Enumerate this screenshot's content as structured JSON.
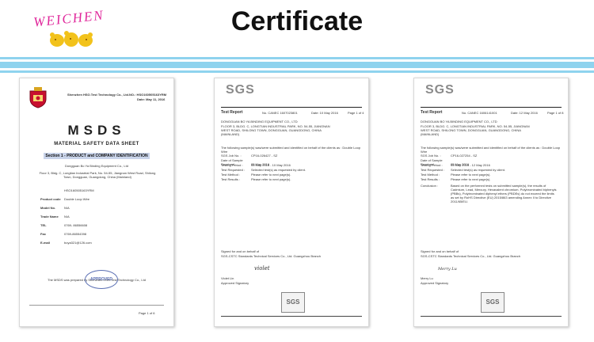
{
  "brand": {
    "logo_text": "WEICHEN"
  },
  "header": {
    "title": "Certificate"
  },
  "colors": {
    "stripe": "#8fd3ee",
    "logo": "#e0279b",
    "stamp": "#5a6fb3"
  },
  "doc1": {
    "company": "Shenzhen HSO.Test Technology Co., Ltd.",
    "report_no": "NO.: HSO160505163YRM",
    "date": "Date: May 11, 2016",
    "title": "MSDS",
    "subtitle": "MATERIAL SAFETY DATA SHEET",
    "section": "Section 1 - PRODUCT and COMPANY IDENTIFICATION",
    "applicant": "Dongguan  Bo Ya Binding Equipment Co., Ltd",
    "address": "Floor 3, Bldg. C, Longtian Industrial Park, No. 54-55, Jiangnan West Road, Shilong Town, Dongguan, Guangdong, China (Mainland)",
    "fields": [
      {
        "label": "",
        "value": "HSO160505163YRM"
      },
      {
        "label": "Product code",
        "value": "Double Loop Wire"
      },
      {
        "label": "Model No.",
        "value": "N/A"
      },
      {
        "label": "Trade Name",
        "value": "N/A"
      },
      {
        "label": "TEL",
        "value": "0769- 86556608"
      },
      {
        "label": "Fax",
        "value": "0769-86554398"
      },
      {
        "label": "E-mail",
        "value": "boya321@126.com"
      }
    ],
    "footer_note": "The MSDS was prepared by Shenzhen HSO.Test Technology Co., Ltd",
    "stamp": "APPROVED",
    "page": "Page 1 of 6"
  },
  "doc2": {
    "sgs": "SGS",
    "report_label": "Test Report",
    "report_no": "No. CANEC 1607023801",
    "date": "Date: 10 May 2016",
    "page": "Page 1 of 4",
    "client": "DONGGUAN  BO YA BINDING EQUIPMENT CO., LTD",
    "address": "FLOOR 3, BLDG. C, LONGTIAN INDUSTRIAL PARK, NO. 54-55, JIANGNAN WEST ROAD, SHILONG TOWN, DONGGUAN, GUANGDONG, CHINA (MAINLAND)",
    "intro": "The following sample(s) was/were submitted and identified on behalf of the clients as : Double Loop Wire",
    "fields": [
      {
        "label": "SGS Job No. :",
        "value": "CP16-026427 - SZ"
      },
      {
        "label": "Date of Sample Received :",
        "value": "05 May 2016"
      },
      {
        "label": "Testing Period :",
        "value": "05 May 2016 - 10 May 2016"
      },
      {
        "label": "Test Requested :",
        "value": "Selected test(s) as requested by client."
      },
      {
        "label": "Test Method :",
        "value": "Please refer to next page(s)."
      },
      {
        "label": "Test Results :",
        "value": "Please refer to next page(s)."
      }
    ],
    "signed": "Signed for and on behalf of",
    "signed_company": "SGS-CSTC Standards Technical Services Co., Ltd. Guangzhou Branch",
    "signature": "violet",
    "signer": "Violet Lin",
    "signer_title": "Approved Signatory"
  },
  "doc3": {
    "sgs": "SGS",
    "report_label": "Test Report",
    "report_no": "No. CANEC 1606141001",
    "date": "Date: 12 May 2016",
    "page": "Page 1 of 8",
    "client": "DONGGUAN  BO YA BINDING EQUIPMENT CO., LTD",
    "address": "FLOOR 3, BLDG. C, LONGTIAN INDUSTRIAL PARK, NO. 54-55, JIANGNAN WEST ROAD, SHILONG TOWN, DONGGUAN, GUANGDONG, CHINA (MAINLAND)",
    "intro": "The following sample(s) was/were submitted and identified on behalf of the clients as : Double Loop Wire",
    "fields": [
      {
        "label": "SGS Job No. :",
        "value": "CP16-027254 - SZ"
      },
      {
        "label": "Date of Sample Received :",
        "value": "05 May 2016"
      },
      {
        "label": "Testing Period :",
        "value": "05 May 2016 - 12 May 2016"
      },
      {
        "label": "Test Requested :",
        "value": "Selected test(s) as requested by client."
      },
      {
        "label": "Test Method :",
        "value": "Please refer to next page(s)."
      },
      {
        "label": "Test Results :",
        "value": "Please refer to next page(s)."
      },
      {
        "label": "Conclusion :",
        "value": "Based on the performed tests on submitted sample(s), the results of Cadmium, Lead, Mercury, Hexavalent chromium, Polybrominated biphenyls (PBBs), Polybrominated diphenyl ethers (PBDEs) do not exceed the limits as set by RoHS Directive (EU) 2015/863 amending Annex II to Directive 2011/65/EU."
      }
    ],
    "signed": "Signed for and on behalf of",
    "signed_company": "SGS-CSTC Standards Technical Services Co., Ltd. Guangzhou Branch",
    "signature": "Merry Lu",
    "signer": "Merry Lu",
    "signer_title": "Approved Signatory"
  }
}
